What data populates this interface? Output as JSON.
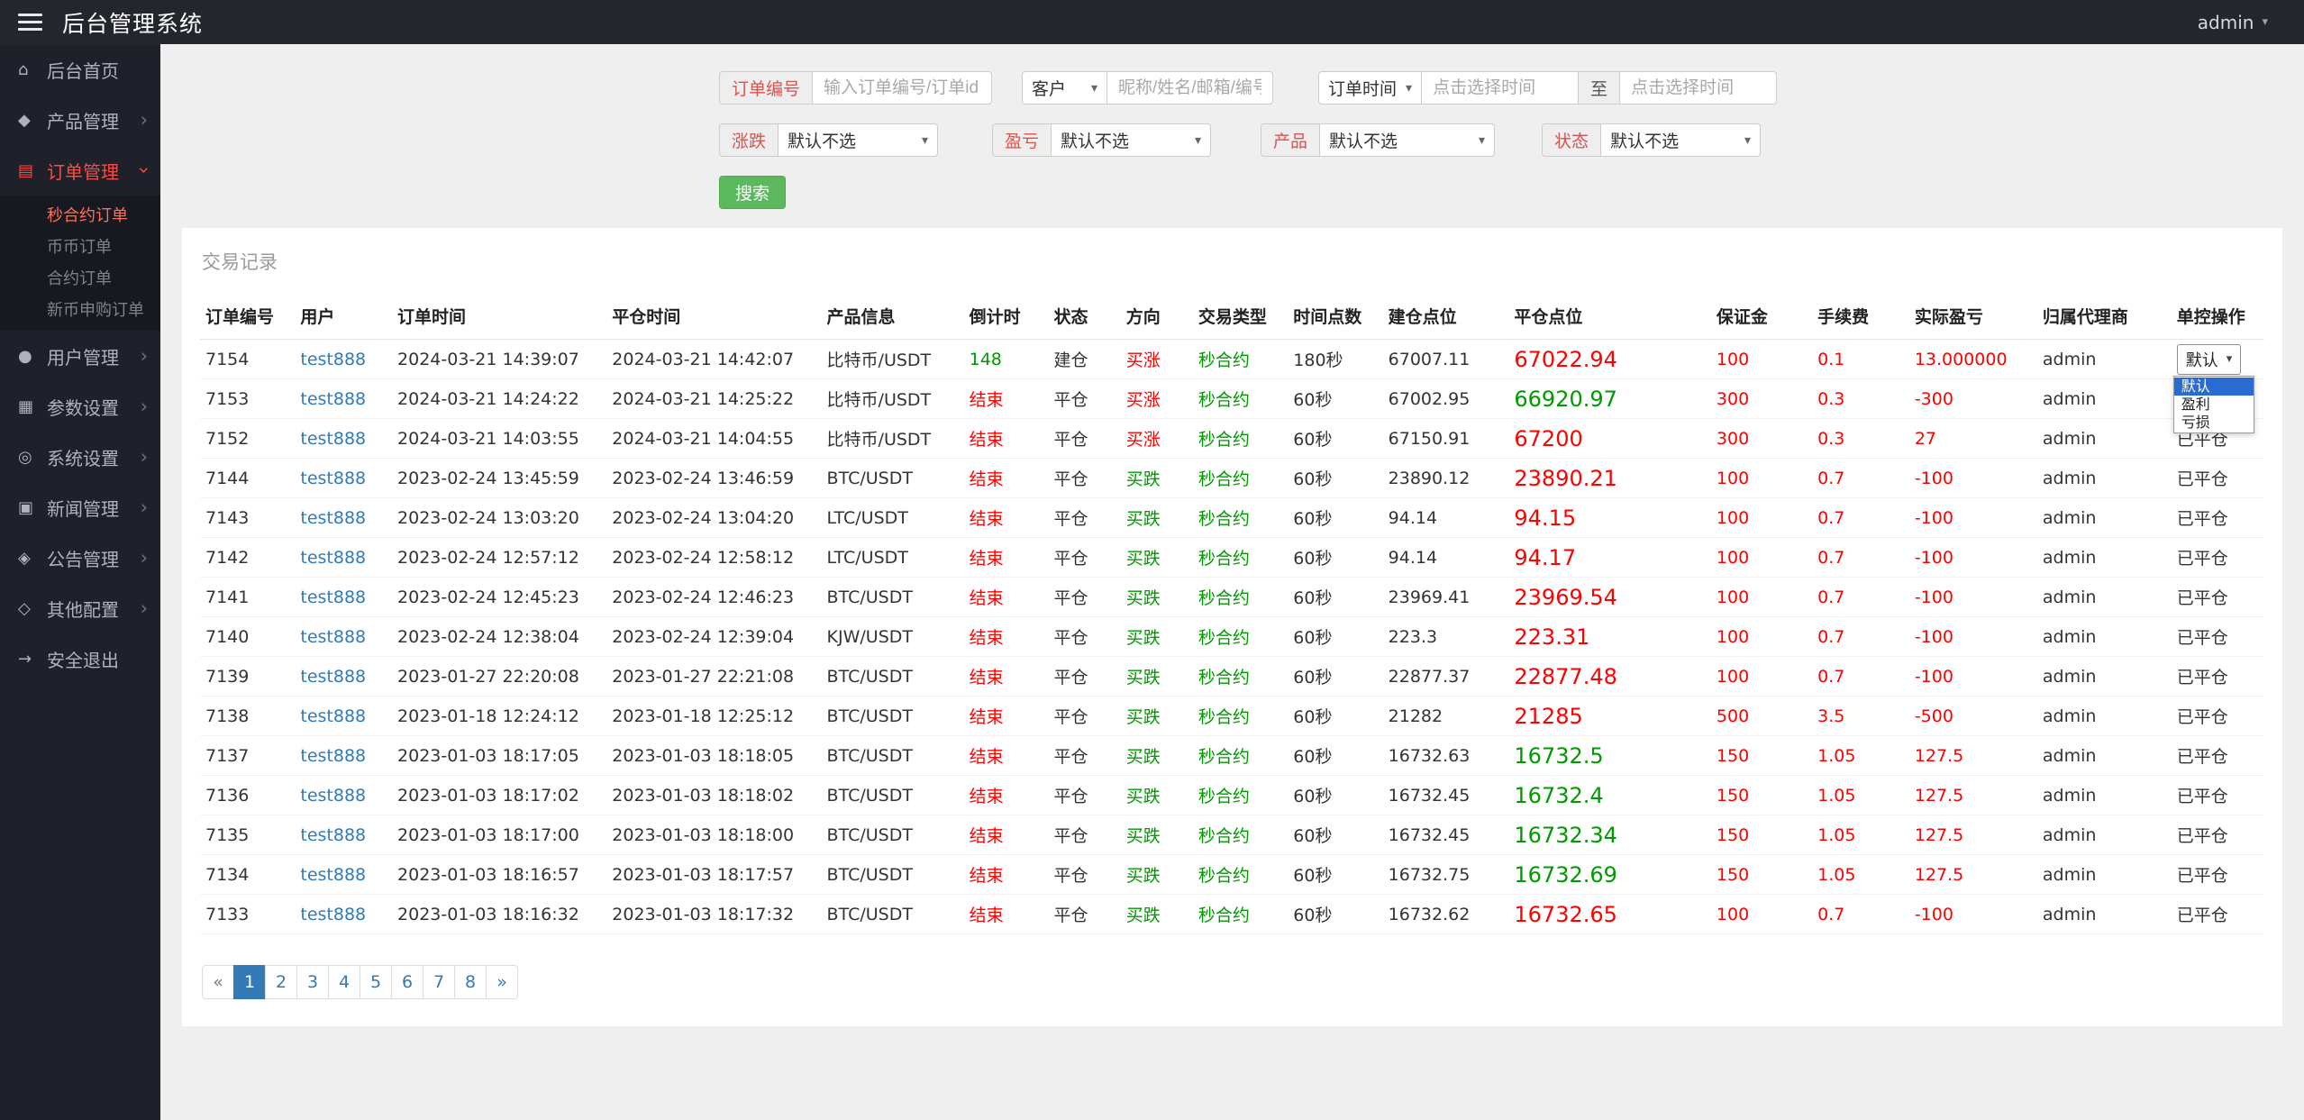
{
  "navbar": {
    "title": "后台管理系统",
    "user": "admin"
  },
  "sidebar": {
    "items": [
      {
        "id": "home",
        "label": "后台首页",
        "icon": "home-icon",
        "glyph": "⌂",
        "expandable": false,
        "active": false
      },
      {
        "id": "products",
        "label": "产品管理",
        "icon": "product-icon",
        "glyph": "◆",
        "expandable": true,
        "active": false
      },
      {
        "id": "orders",
        "label": "订单管理",
        "icon": "order-icon",
        "glyph": "▤",
        "expandable": true,
        "active": true,
        "children": [
          {
            "label": "秒合约订单",
            "active": true
          },
          {
            "label": "币币订单",
            "active": false
          },
          {
            "label": "合约订单",
            "active": false
          },
          {
            "label": "新币申购订单",
            "active": false
          }
        ]
      },
      {
        "id": "users",
        "label": "用户管理",
        "icon": "user-icon",
        "glyph": "●",
        "expandable": true,
        "active": false
      },
      {
        "id": "params",
        "label": "参数设置",
        "icon": "params-icon",
        "glyph": "▦",
        "expandable": true,
        "active": false
      },
      {
        "id": "system",
        "label": "系统设置",
        "icon": "gear-icon",
        "glyph": "◎",
        "expandable": true,
        "active": false
      },
      {
        "id": "news",
        "label": "新闻管理",
        "icon": "news-icon",
        "glyph": "▣",
        "expandable": true,
        "active": false
      },
      {
        "id": "notice",
        "label": "公告管理",
        "icon": "announcement-icon",
        "glyph": "◈",
        "expandable": true,
        "active": false
      },
      {
        "id": "other",
        "label": "其他配置",
        "icon": "config-icon",
        "glyph": "◇",
        "expandable": true,
        "active": false
      },
      {
        "id": "logout",
        "label": "安全退出",
        "icon": "logout-icon",
        "glyph": "→",
        "expandable": false,
        "active": false
      }
    ]
  },
  "filters": {
    "order_no_label": "订单编号",
    "order_no_placeholder": "输入订单编号/订单id",
    "customer_select": "客户",
    "customer_placeholder": "昵称/姓名/邮箱/编号",
    "time_select": "订单时间",
    "time_from_placeholder": "点击选择时间",
    "to_label": "至",
    "time_to_placeholder": "点击选择时间",
    "rise_fall_label": "涨跌",
    "profit_loss_label": "盈亏",
    "product_label": "产品",
    "status_label": "状态",
    "default_option": "默认不选",
    "search_button": "搜索"
  },
  "panel": {
    "title": "交易记录"
  },
  "table": {
    "headers": [
      "订单编号",
      "用户",
      "订单时间",
      "平仓时间",
      "产品信息",
      "倒计时",
      "状态",
      "方向",
      "交易类型",
      "时间点数",
      "建仓点位",
      "平仓点位",
      "保证金",
      "手续费",
      "实际盈亏",
      "归属代理商",
      "单控操作"
    ],
    "control_select": {
      "value": "默认",
      "options": [
        "默认",
        "盈利",
        "亏损"
      ],
      "selected": "默认"
    },
    "rows": [
      {
        "order_no": "7154",
        "user": "test888",
        "order_time": "2024-03-21 14:39:07",
        "close_time": "2024-03-21 14:42:07",
        "product": "比特币/USDT",
        "countdown": "148",
        "countdown_color": "green",
        "status": "建仓",
        "direction": "买涨",
        "direction_color": "red",
        "trade_type": "秒合约",
        "duration": "180秒",
        "open_price": "67007.11",
        "close_price": "67022.94",
        "close_price_color": "red",
        "margin": "100",
        "fee": "0.1",
        "profit": "13.000000",
        "agent": "admin",
        "control": "select"
      },
      {
        "order_no": "7153",
        "user": "test888",
        "order_time": "2024-03-21 14:24:22",
        "close_time": "2024-03-21 14:25:22",
        "product": "比特币/USDT",
        "countdown": "结束",
        "countdown_color": "red",
        "status": "平仓",
        "direction": "买涨",
        "direction_color": "red",
        "trade_type": "秒合约",
        "duration": "60秒",
        "open_price": "67002.95",
        "close_price": "66920.97",
        "close_price_color": "green",
        "margin": "300",
        "fee": "0.3",
        "profit": "-300",
        "agent": "admin",
        "control": ""
      },
      {
        "order_no": "7152",
        "user": "test888",
        "order_time": "2024-03-21 14:03:55",
        "close_time": "2024-03-21 14:04:55",
        "product": "比特币/USDT",
        "countdown": "结束",
        "countdown_color": "red",
        "status": "平仓",
        "direction": "买涨",
        "direction_color": "red",
        "trade_type": "秒合约",
        "duration": "60秒",
        "open_price": "67150.91",
        "close_price": "67200",
        "close_price_color": "red",
        "margin": "300",
        "fee": "0.3",
        "profit": "27",
        "agent": "admin",
        "control": "已平仓"
      },
      {
        "order_no": "7144",
        "user": "test888",
        "order_time": "2023-02-24 13:45:59",
        "close_time": "2023-02-24 13:46:59",
        "product": "BTC/USDT",
        "countdown": "结束",
        "countdown_color": "red",
        "status": "平仓",
        "direction": "买跌",
        "direction_color": "green",
        "trade_type": "秒合约",
        "duration": "60秒",
        "open_price": "23890.12",
        "close_price": "23890.21",
        "close_price_color": "red",
        "margin": "100",
        "fee": "0.7",
        "profit": "-100",
        "agent": "admin",
        "control": "已平仓"
      },
      {
        "order_no": "7143",
        "user": "test888",
        "order_time": "2023-02-24 13:03:20",
        "close_time": "2023-02-24 13:04:20",
        "product": "LTC/USDT",
        "countdown": "结束",
        "countdown_color": "red",
        "status": "平仓",
        "direction": "买跌",
        "direction_color": "green",
        "trade_type": "秒合约",
        "duration": "60秒",
        "open_price": "94.14",
        "close_price": "94.15",
        "close_price_color": "red",
        "margin": "100",
        "fee": "0.7",
        "profit": "-100",
        "agent": "admin",
        "control": "已平仓"
      },
      {
        "order_no": "7142",
        "user": "test888",
        "order_time": "2023-02-24 12:57:12",
        "close_time": "2023-02-24 12:58:12",
        "product": "LTC/USDT",
        "countdown": "结束",
        "countdown_color": "red",
        "status": "平仓",
        "direction": "买跌",
        "direction_color": "green",
        "trade_type": "秒合约",
        "duration": "60秒",
        "open_price": "94.14",
        "close_price": "94.17",
        "close_price_color": "red",
        "margin": "100",
        "fee": "0.7",
        "profit": "-100",
        "agent": "admin",
        "control": "已平仓"
      },
      {
        "order_no": "7141",
        "user": "test888",
        "order_time": "2023-02-24 12:45:23",
        "close_time": "2023-02-24 12:46:23",
        "product": "BTC/USDT",
        "countdown": "结束",
        "countdown_color": "red",
        "status": "平仓",
        "direction": "买跌",
        "direction_color": "green",
        "trade_type": "秒合约",
        "duration": "60秒",
        "open_price": "23969.41",
        "close_price": "23969.54",
        "close_price_color": "red",
        "margin": "100",
        "fee": "0.7",
        "profit": "-100",
        "agent": "admin",
        "control": "已平仓"
      },
      {
        "order_no": "7140",
        "user": "test888",
        "order_time": "2023-02-24 12:38:04",
        "close_time": "2023-02-24 12:39:04",
        "product": "KJW/USDT",
        "countdown": "结束",
        "countdown_color": "red",
        "status": "平仓",
        "direction": "买跌",
        "direction_color": "green",
        "trade_type": "秒合约",
        "duration": "60秒",
        "open_price": "223.3",
        "close_price": "223.31",
        "close_price_color": "red",
        "margin": "100",
        "fee": "0.7",
        "profit": "-100",
        "agent": "admin",
        "control": "已平仓"
      },
      {
        "order_no": "7139",
        "user": "test888",
        "order_time": "2023-01-27 22:20:08",
        "close_time": "2023-01-27 22:21:08",
        "product": "BTC/USDT",
        "countdown": "结束",
        "countdown_color": "red",
        "status": "平仓",
        "direction": "买跌",
        "direction_color": "green",
        "trade_type": "秒合约",
        "duration": "60秒",
        "open_price": "22877.37",
        "close_price": "22877.48",
        "close_price_color": "red",
        "margin": "100",
        "fee": "0.7",
        "profit": "-100",
        "agent": "admin",
        "control": "已平仓"
      },
      {
        "order_no": "7138",
        "user": "test888",
        "order_time": "2023-01-18 12:24:12",
        "close_time": "2023-01-18 12:25:12",
        "product": "BTC/USDT",
        "countdown": "结束",
        "countdown_color": "red",
        "status": "平仓",
        "direction": "买跌",
        "direction_color": "green",
        "trade_type": "秒合约",
        "duration": "60秒",
        "open_price": "21282",
        "close_price": "21285",
        "close_price_color": "red",
        "margin": "500",
        "fee": "3.5",
        "profit": "-500",
        "agent": "admin",
        "control": "已平仓"
      },
      {
        "order_no": "7137",
        "user": "test888",
        "order_time": "2023-01-03 18:17:05",
        "close_time": "2023-01-03 18:18:05",
        "product": "BTC/USDT",
        "countdown": "结束",
        "countdown_color": "red",
        "status": "平仓",
        "direction": "买跌",
        "direction_color": "green",
        "trade_type": "秒合约",
        "duration": "60秒",
        "open_price": "16732.63",
        "close_price": "16732.5",
        "close_price_color": "green",
        "margin": "150",
        "fee": "1.05",
        "profit": "127.5",
        "agent": "admin",
        "control": "已平仓"
      },
      {
        "order_no": "7136",
        "user": "test888",
        "order_time": "2023-01-03 18:17:02",
        "close_time": "2023-01-03 18:18:02",
        "product": "BTC/USDT",
        "countdown": "结束",
        "countdown_color": "red",
        "status": "平仓",
        "direction": "买跌",
        "direction_color": "green",
        "trade_type": "秒合约",
        "duration": "60秒",
        "open_price": "16732.45",
        "close_price": "16732.4",
        "close_price_color": "green",
        "margin": "150",
        "fee": "1.05",
        "profit": "127.5",
        "agent": "admin",
        "control": "已平仓"
      },
      {
        "order_no": "7135",
        "user": "test888",
        "order_time": "2023-01-03 18:17:00",
        "close_time": "2023-01-03 18:18:00",
        "product": "BTC/USDT",
        "countdown": "结束",
        "countdown_color": "red",
        "status": "平仓",
        "direction": "买跌",
        "direction_color": "green",
        "trade_type": "秒合约",
        "duration": "60秒",
        "open_price": "16732.45",
        "close_price": "16732.34",
        "close_price_color": "green",
        "margin": "150",
        "fee": "1.05",
        "profit": "127.5",
        "agent": "admin",
        "control": "已平仓"
      },
      {
        "order_no": "7134",
        "user": "test888",
        "order_time": "2023-01-03 18:16:57",
        "close_time": "2023-01-03 18:17:57",
        "product": "BTC/USDT",
        "countdown": "结束",
        "countdown_color": "red",
        "status": "平仓",
        "direction": "买跌",
        "direction_color": "green",
        "trade_type": "秒合约",
        "duration": "60秒",
        "open_price": "16732.75",
        "close_price": "16732.69",
        "close_price_color": "green",
        "margin": "150",
        "fee": "1.05",
        "profit": "127.5",
        "agent": "admin",
        "control": "已平仓"
      },
      {
        "order_no": "7133",
        "user": "test888",
        "order_time": "2023-01-03 18:16:32",
        "close_time": "2023-01-03 18:17:32",
        "product": "BTC/USDT",
        "countdown": "结束",
        "countdown_color": "red",
        "status": "平仓",
        "direction": "买跌",
        "direction_color": "green",
        "trade_type": "秒合约",
        "duration": "60秒",
        "open_price": "16732.62",
        "close_price": "16732.65",
        "close_price_color": "red",
        "margin": "100",
        "fee": "0.7",
        "profit": "-100",
        "agent": "admin",
        "control": "已平仓"
      }
    ]
  },
  "pagination": {
    "items": [
      {
        "label": "«",
        "muted": true
      },
      {
        "label": "1",
        "active": true
      },
      {
        "label": "2"
      },
      {
        "label": "3"
      },
      {
        "label": "4"
      },
      {
        "label": "5"
      },
      {
        "label": "6"
      },
      {
        "label": "7"
      },
      {
        "label": "8"
      },
      {
        "label": "»"
      }
    ]
  },
  "colors": {
    "red": "#ff0000",
    "green": "#009900",
    "link_blue": "#337ab7",
    "pagination_active_blue": "#337ab7",
    "button_green": "#5cb85c",
    "sidebar_active_red": "#ff4a42",
    "submenu_active_red": "#ff6e55",
    "popup_selected_blue": "#2a6bd2",
    "addon_label_red": "#d9534f"
  }
}
